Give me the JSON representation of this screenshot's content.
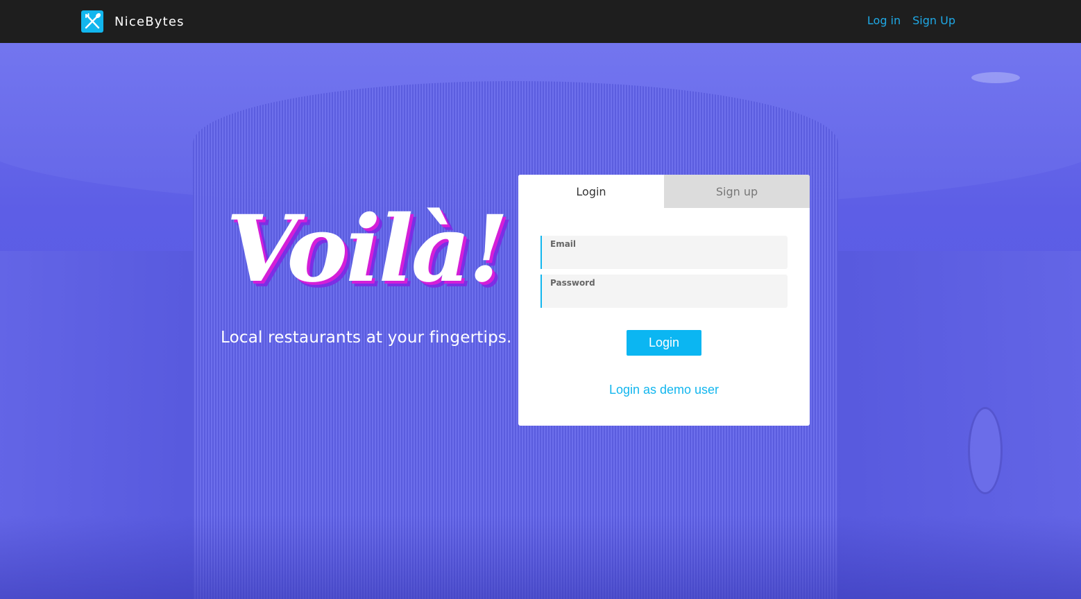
{
  "navbar": {
    "brand_name": "NiceBytes",
    "brand_icon": "fork-knife-icon",
    "links": [
      {
        "label": "Log in"
      },
      {
        "label": "Sign Up"
      }
    ]
  },
  "hero": {
    "title": "Voilà!",
    "tagline": "Local restaurants at your fingertips."
  },
  "auth": {
    "tabs": [
      {
        "label": "Login",
        "active": true
      },
      {
        "label": "Sign up",
        "active": false
      }
    ],
    "email": {
      "label": "Email",
      "value": ""
    },
    "password": {
      "label": "Password",
      "value": ""
    },
    "submit_label": "Login",
    "demo_label": "Login as demo user"
  },
  "colors": {
    "accent": "#12b6ee",
    "navbar_bg": "#1e1e1e",
    "nav_link": "#1fa9e6",
    "hero_bg": "#5b5fe0",
    "title_shadow_pink": "#d41fd8",
    "title_shadow_purple": "#7b2fe4",
    "tab_inactive_bg": "#dcdcdc"
  }
}
